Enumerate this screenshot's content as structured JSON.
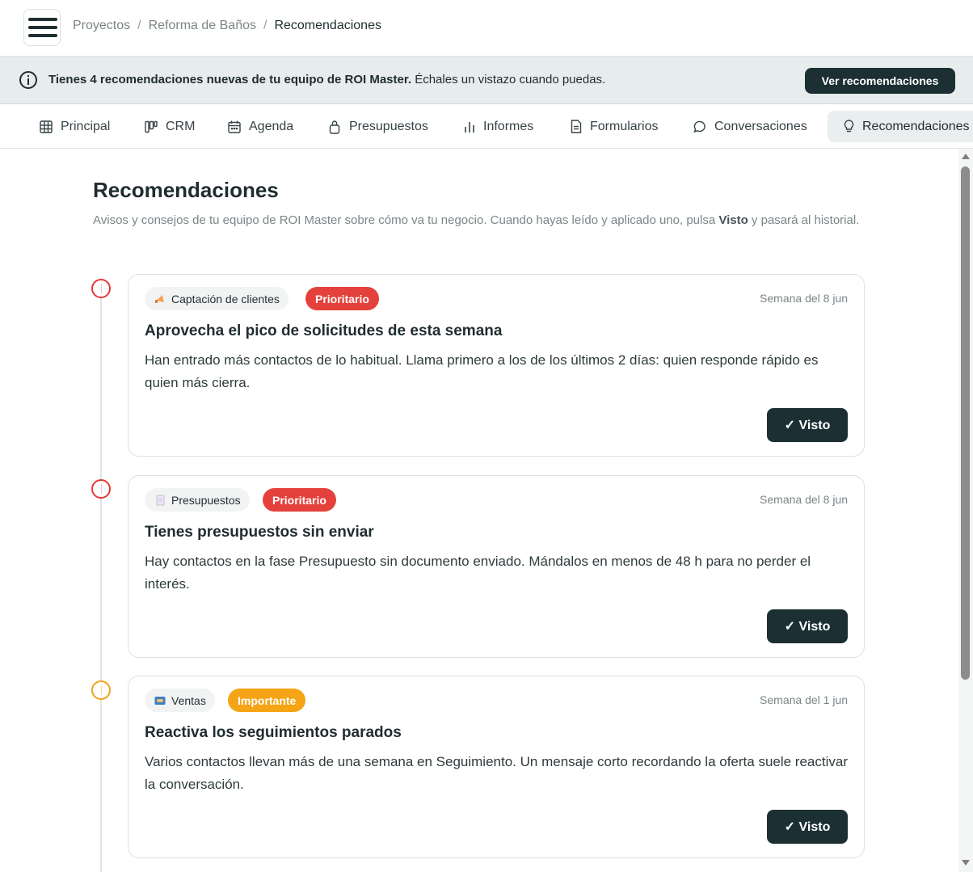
{
  "breadcrumb": {
    "items": [
      "Proyectos",
      "Reforma de Baños"
    ],
    "separator": "/",
    "current": "Recomendaciones"
  },
  "banner": {
    "bold_text": "Tienes 4 recomendaciones nuevas de tu equipo de ROI Master.",
    "text": " Échales un vistazo cuando puedas.",
    "button_label": "Ver recomendaciones"
  },
  "tabs": [
    {
      "label": "Principal",
      "icon": "grid-icon"
    },
    {
      "label": "CRM",
      "icon": "kanban-icon"
    },
    {
      "label": "Agenda",
      "icon": "calendar-icon"
    },
    {
      "label": "Presupuestos",
      "icon": "bag-icon"
    },
    {
      "label": "Informes",
      "icon": "bar-chart-icon"
    },
    {
      "label": "Formularios",
      "icon": "document-icon"
    },
    {
      "label": "Conversaciones",
      "icon": "chat-bubble-icon"
    },
    {
      "label": "Recomendaciones",
      "icon": "lightbulb-icon",
      "active": true
    }
  ],
  "page": {
    "title": "Recomendaciones",
    "desc_before": "Avisos y consejos de tu equipo de ROI Master sobre cómo va tu negocio. Cuando hayas leído y aplicado uno, pulsa ",
    "desc_bold": "Visto",
    "desc_after": " y pasará al historial."
  },
  "recommendations": [
    {
      "category": "Captación de clientes",
      "category_icon": "megaphone-icon",
      "priority": "Prioritario",
      "priority_color": "#e5413c",
      "week": "Semana del 8 jun",
      "title": "Aprovecha el pico de solicitudes de esta semana",
      "body": "Han entrado más contactos de lo habitual. Llama primero a los de los últimos 2 días: quien responde rápido es quien más cierra.",
      "button_label": "✓ Visto"
    },
    {
      "category": "Presupuestos",
      "category_icon": "memo-icon",
      "priority": "Prioritario",
      "priority_color": "#e5413c",
      "week": "Semana del 8 jun",
      "title": "Tienes presupuestos sin enviar",
      "body": "Hay contactos en la fase Presupuesto sin documento enviado. Mándalos en menos de 48 h para no perder el interés.",
      "button_label": "✓ Visto"
    },
    {
      "category": "Ventas",
      "category_icon": "handshake-icon",
      "priority": "Importante",
      "priority_color": "#f4a414",
      "week": "Semana del 1 jun",
      "title": "Reactiva los seguimientos parados",
      "body": "Varios contactos llevan más de una semana en Seguimiento. Un mensaje corto recordando la oferta suele reactivar la conversación.",
      "button_label": "✓ Visto"
    }
  ]
}
